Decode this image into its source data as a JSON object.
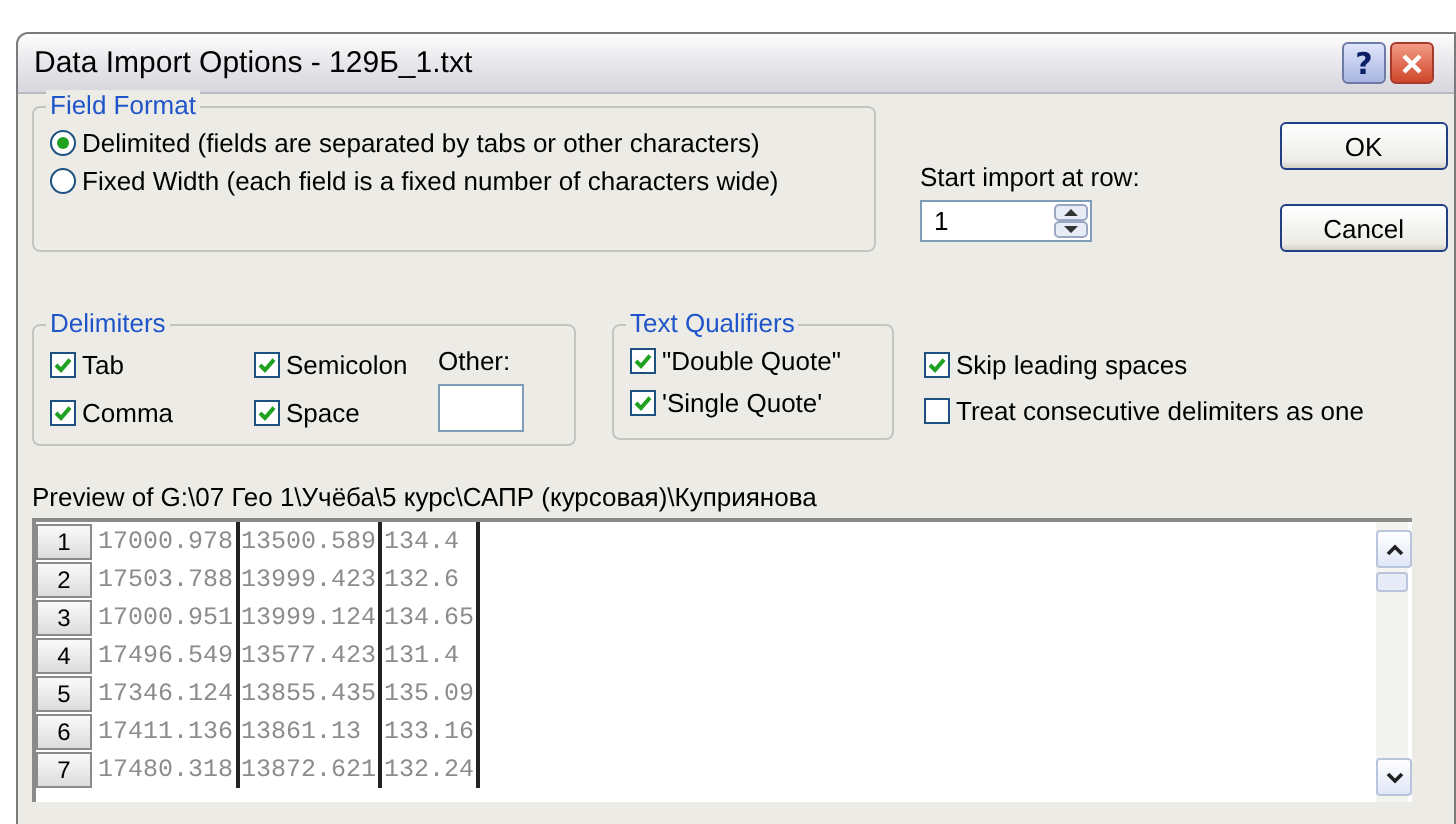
{
  "window": {
    "title": "Data Import Options - 129Б_1.txt",
    "help_button": "?"
  },
  "field_format": {
    "title": "Field Format",
    "options": [
      {
        "label": "Delimited (fields are separated by tabs or other characters)",
        "selected": true
      },
      {
        "label": "Fixed Width (each field is a fixed number of characters wide)",
        "selected": false
      }
    ]
  },
  "start_import": {
    "label": "Start import at row:",
    "value": "1"
  },
  "buttons": [
    "OK",
    "Cancel"
  ],
  "delimiters": {
    "title": "Delimiters",
    "items": [
      {
        "label": "Tab",
        "checked": true
      },
      {
        "label": "Semicolon",
        "checked": true
      },
      {
        "label": "Comma",
        "checked": true
      },
      {
        "label": "Space",
        "checked": true
      }
    ],
    "other_label": "Other:"
  },
  "text_qualifiers": {
    "title": "Text Qualifiers",
    "items": [
      {
        "label": "\"Double Quote\"",
        "checked": true
      },
      {
        "label": "'Single Quote'",
        "checked": true
      }
    ]
  },
  "options": [
    {
      "label": "Skip leading spaces",
      "checked": true
    },
    {
      "label": "Treat consecutive delimiters as one",
      "checked": false
    }
  ],
  "preview": {
    "label": "Preview of G:\\07 Гео 1\\Учёба\\5 курс\\САПР (курсовая)\\Куприянова",
    "rows": [
      {
        "number": "1",
        "cells": [
          "17000.978",
          "13500.589",
          "134.4"
        ]
      },
      {
        "number": "2",
        "cells": [
          "17503.788",
          "13999.423",
          "132.6"
        ]
      },
      {
        "number": "3",
        "cells": [
          "17000.951",
          "13999.124",
          "134.65"
        ]
      },
      {
        "number": "4",
        "cells": [
          "17496.549",
          "13577.423",
          "131.4"
        ]
      },
      {
        "number": "5",
        "cells": [
          "17346.124",
          "13855.435",
          "135.09"
        ]
      },
      {
        "number": "6",
        "cells": [
          "17411.136",
          "13861.13",
          "133.16"
        ]
      },
      {
        "number": "7",
        "cells": [
          "17480.318",
          "13872.621",
          "132.24"
        ]
      }
    ]
  }
}
